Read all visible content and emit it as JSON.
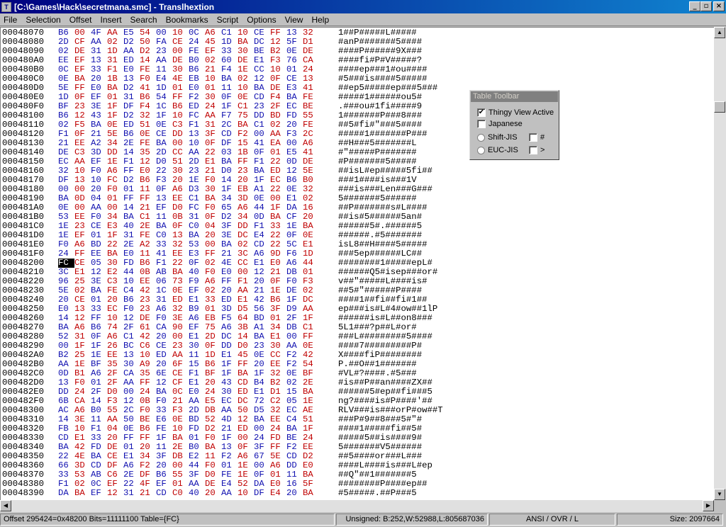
{
  "window": {
    "title": "[C:\\Games\\Hack\\secretmana.smc] - Translhextion",
    "controls": {
      "minimize": "_",
      "maximize": "▫",
      "close": "×"
    }
  },
  "menu": [
    "File",
    "Selection",
    "Offset",
    "Insert",
    "Search",
    "Bookmarks",
    "Script",
    "Options",
    "View",
    "Help"
  ],
  "table_toolbar": {
    "title": "Table Toolbar",
    "thingy_view_active": {
      "label": "Thingy View Active",
      "checked": true
    },
    "japanese": {
      "label": "Japanese",
      "checked": false
    },
    "shift_jis": {
      "label": "Shift-JIS",
      "selected": false
    },
    "euc_jis": {
      "label": "EUC-JIS",
      "selected": false
    },
    "hash": {
      "label": "#",
      "checked": false
    },
    "gt": {
      "label": ">",
      "checked": false
    }
  },
  "selected_offset": "00048200",
  "rows": [
    {
      "addr": "00048070",
      "hex": "B6 00 4F AA E5 54 00 10 0C A6 C1 10 CE FF 13 32",
      "ascii": "1##P#####L#####"
    },
    {
      "addr": "00048080",
      "hex": "2D CF AA 02 D2 50 FA CE 24 45 1D BA DC 12 5F D1",
      "ascii": "#anP#######5####"
    },
    {
      "addr": "00048090",
      "hex": "02 DE 31 1D AA D2 23 00 FE EF 33 30 BE B2 0E DE",
      "ascii": "####P######9X###"
    },
    {
      "addr": "000480A0",
      "hex": "EE EF 13 31 ED 14 AA DE B0 02 60 DE E1 F3 76 CA",
      "ascii": "####fi#P#V#####?"
    },
    {
      "addr": "000480B0",
      "hex": "0C EF 33 F1 E0 FE 11 30 B6 21 F4 1E CC 10 01 24",
      "ascii": "####ep###1#ou####"
    },
    {
      "addr": "000480C0",
      "hex": "0E BA 20 1B 13 F0 E4 4E EB 10 BA 02 12 0F CE 13",
      "ascii": "#5###is####5#####"
    },
    {
      "addr": "000480D0",
      "hex": "5E FF E0 BA D2 41 1D 01 E0 01 11 10 BA DE E3 41",
      "ascii": "##ep5#####ep###5###"
    },
    {
      "addr": "000480E0",
      "hex": "1D 0F EF 01 31 B6 54 FF F2 30 0F 0E CD F4 BA FE",
      "ascii": "#####1######ou5#"
    },
    {
      "addr": "000480F0",
      "hex": "BF 23 3E 1F DF F4 1C B6 ED 24 1F C1 23 2F EC BE",
      "ascii": ".###ou#1fi#####9"
    },
    {
      "addr": "00048100",
      "hex": "B6 12 43 1F D2 32 1F 10 FC AA F7 75 DD BD FD 55",
      "ascii": "1#######P###8###"
    },
    {
      "addr": "00048110",
      "hex": "02 F5 BA 0E ED 51 0E C3 F1 31 2C BA C1 02 20 FE",
      "ascii": "##5#fi#\"###5####"
    },
    {
      "addr": "00048120",
      "hex": "F1 0F 21 5E B6 0E CE DD 13 3F CD F2 00 AA F3 2C",
      "ascii": "#####1#######P###"
    },
    {
      "addr": "00048130",
      "hex": "21 EE A2 34 2E FE BA 00 10 0F DF 15 41 EA 00 A6",
      "ascii": "##H###5#######L"
    },
    {
      "addr": "00048140",
      "hex": "DE C3 3D DD 14 35 2D CC AA 22 03 1B 0F 01 E5 41",
      "ascii": "#\"#####P#######"
    },
    {
      "addr": "00048150",
      "hex": "EC AA EF 1E F1 12 D0 51 2D E1 BA FF F1 22 0D DE",
      "ascii": "#P#######5#####"
    },
    {
      "addr": "00048160",
      "hex": "32 10 F0 A6 FF E0 22 30 23 21 D0 23 BA ED 12 5E",
      "ascii": "##isL#ep#####5fi##"
    },
    {
      "addr": "00048170",
      "hex": "DF 13 10 FC D2 B6 F3 20 1E F0 14 20 1F EC B6 B0",
      "ascii": "###1####is###1V"
    },
    {
      "addr": "00048180",
      "hex": "00 00 20 F0 01 11 0F A6 D3 30 1F EB A1 22 0E 32",
      "ascii": "###is###Len###G###"
    },
    {
      "addr": "00048190",
      "hex": "BA 0D 04 01 FF FF 13 EE C1 BA 34 3D 0E 00 E1 02",
      "ascii": "5#######5######"
    },
    {
      "addr": "000481A0",
      "hex": "0E 00 AA 00 14 21 EF D0 FC F0 65 A6 44 1F DA 16",
      "ascii": "##P#######s#L####"
    },
    {
      "addr": "000481B0",
      "hex": "53 EE F0 34 BA C1 11 0B 31 0F D2 34 0D BA CF 20",
      "ascii": "##is#5######5an#"
    },
    {
      "addr": "000481C0",
      "hex": "1E 23 CE E3 40 2E BA 0F C0 04 3F DD F1 33 1E BA",
      "ascii": "######5#.######5"
    },
    {
      "addr": "000481D0",
      "hex": "1E EF 01 1F 31 FE C0 13 BA 20 3E DC E4 22 0F 0E",
      "ascii": "######.#5#######"
    },
    {
      "addr": "000481E0",
      "hex": "F0 A6 BD 22 2E A2 33 32 53 00 BA 02 CD 22 5C E1",
      "ascii": "isL8##H####5#####"
    },
    {
      "addr": "000481F0",
      "hex": "24 FF EE BA E0 11 41 EE E3 FF 21 3C A6 9D F6 1D",
      "ascii": "###5ep######LC##"
    },
    {
      "addr": "00048200",
      "hex": "FC CE 05 30 FD B6 F1 22 0F 02 4E CC E1 E0 A6 44",
      "ascii": "########1#####epL#"
    },
    {
      "addr": "00048210",
      "hex": "3C E1 12 E2 44 0B AB BA 40 F0 E0 00 12 21 DB 01",
      "ascii": "######Q5#isep###or#"
    },
    {
      "addr": "00048220",
      "hex": "96 25 3E C3 10 EE 06 73 F9 A6 FF F1 20 0F F0 F3",
      "ascii": "v##\"#####L####is#"
    },
    {
      "addr": "00048230",
      "hex": "5E 02 BA FE C4 42 1C 0E EF 02 20 AA 21 1E DE 02",
      "ascii": "##5#\"######P####"
    },
    {
      "addr": "00048240",
      "hex": "20 CE 01 20 B6 23 31 ED E1 33 ED E1 42 B6 1F DC",
      "ascii": "####1##fi##fi#1##"
    },
    {
      "addr": "00048250",
      "hex": "E0 13 33 EC F0 23 A6 32 B9 01 3D D5 56 3F D9 AA",
      "ascii": "ep###is#L#4#ow##1lP"
    },
    {
      "addr": "00048260",
      "hex": "14 12 FF 10 12 DE F0 3E A6 EB F5 64 BD 01 2F 1F",
      "ascii": "######is#L##on8###"
    },
    {
      "addr": "00048270",
      "hex": "BA A6 B6 74 2F 61 CA 90 EF 75 A6 3B A1 34 DB C1",
      "ascii": "5L1###?p##L#or#"
    },
    {
      "addr": "00048280",
      "hex": "52 31 0F A6 C1 42 20 00 E1 2D DC 14 BA E1 00 FF",
      "ascii": "###L#########5####"
    },
    {
      "addr": "00048290",
      "hex": "00 1F 1F 26 BC C6 CE 23 30 0F DD D0 23 30 AA 0E",
      "ascii": "####7#########P#"
    },
    {
      "addr": "000482A0",
      "hex": "B2 25 1E EE 13 10 ED AA 11 1D E1 45 0E CC F2 42",
      "ascii": "X####fiP########"
    },
    {
      "addr": "000482B0",
      "hex": "AA 1E BF 35 30 A9 20 6F 15 B6 1F FF 20 EE F2 54",
      "ascii": "P.##O##1#######"
    },
    {
      "addr": "000482C0",
      "hex": "0D B1 A6 2F CA 35 6E CE F1 BF 1F BA 1F 32 0E BF",
      "ascii": "#VL#?####.#5###"
    },
    {
      "addr": "000482D0",
      "hex": "13 F0 01 2F AA FF 12 CF E1 20 43 CD B4 B2 02 2E",
      "ascii": "#is##P##an####ZX##"
    },
    {
      "addr": "000482E0",
      "hex": "DD 24 2F D0 00 24 BA 0C E0 24 30 ED E1 D1 15 BA",
      "ascii": "######5#ep##fi###5"
    },
    {
      "addr": "000482F0",
      "hex": "6B CA 14 F3 12 0B F0 21 AA E5 EC DC 72 C2 05 1E",
      "ascii": "ng?####is#P####'##"
    },
    {
      "addr": "00048300",
      "hex": "AC A6 B0 55 2C F0 33 F3 2D DB AA 50 D5 32 EC AE",
      "ascii": "RLV###is###orP#ow##T"
    },
    {
      "addr": "00048310",
      "hex": "14 3E 11 AA 50 BE E6 0E BD 52 4D 12 BA EE C4 51",
      "ascii": "###P#9##8###5#\"#"
    },
    {
      "addr": "00048320",
      "hex": "FB 10 F1 04 0E B6 FE 10 FD D2 21 ED 00 24 BA 1F",
      "ascii": "####1#####fi##5#"
    },
    {
      "addr": "00048330",
      "hex": "CD E1 33 20 FF FF 1F BA 01 F0 1F 00 24 FD BE 24",
      "ascii": "#####5##is####9#"
    },
    {
      "addr": "00048340",
      "hex": "BA 42 FD DE 01 20 11 2E B0 BA 13 0F 3F FF F2 EE",
      "ascii": "5#######V5######"
    },
    {
      "addr": "00048350",
      "hex": "22 4E BA CE E1 34 3F DB E2 11 F2 A6 67 5E CD D2",
      "ascii": "##5####or###L###"
    },
    {
      "addr": "00048360",
      "hex": "66 3D CD DF A6 F2 20 00 44 F0 01 1E 00 A6 DD E0",
      "ascii": "####L####is###L#ep"
    },
    {
      "addr": "00048370",
      "hex": "33 53 AB C6 2E DF B6 55 3F D0 FE 1E 0F 01 11 BA",
      "ascii": "##Q\"##1#######5"
    },
    {
      "addr": "00048380",
      "hex": "F1 02 0C EF 22 4F EF 01 AA DE E4 52 DA E0 16 5F",
      "ascii": "########P####ep##"
    },
    {
      "addr": "00048390",
      "hex": "DA BA EF 12 31 21 CD C0 40 20 AA 10 DF E4 20 BA",
      "ascii": "#5#####.##P###5"
    }
  ],
  "status": {
    "offset": "Offset 295424=0x48200   Bits=11111100   Table={FC}",
    "values": "Unsigned: B:252,W:52988,L:805687036",
    "mode": "ANSI / OVR / L",
    "size": "Size: 2097664"
  }
}
